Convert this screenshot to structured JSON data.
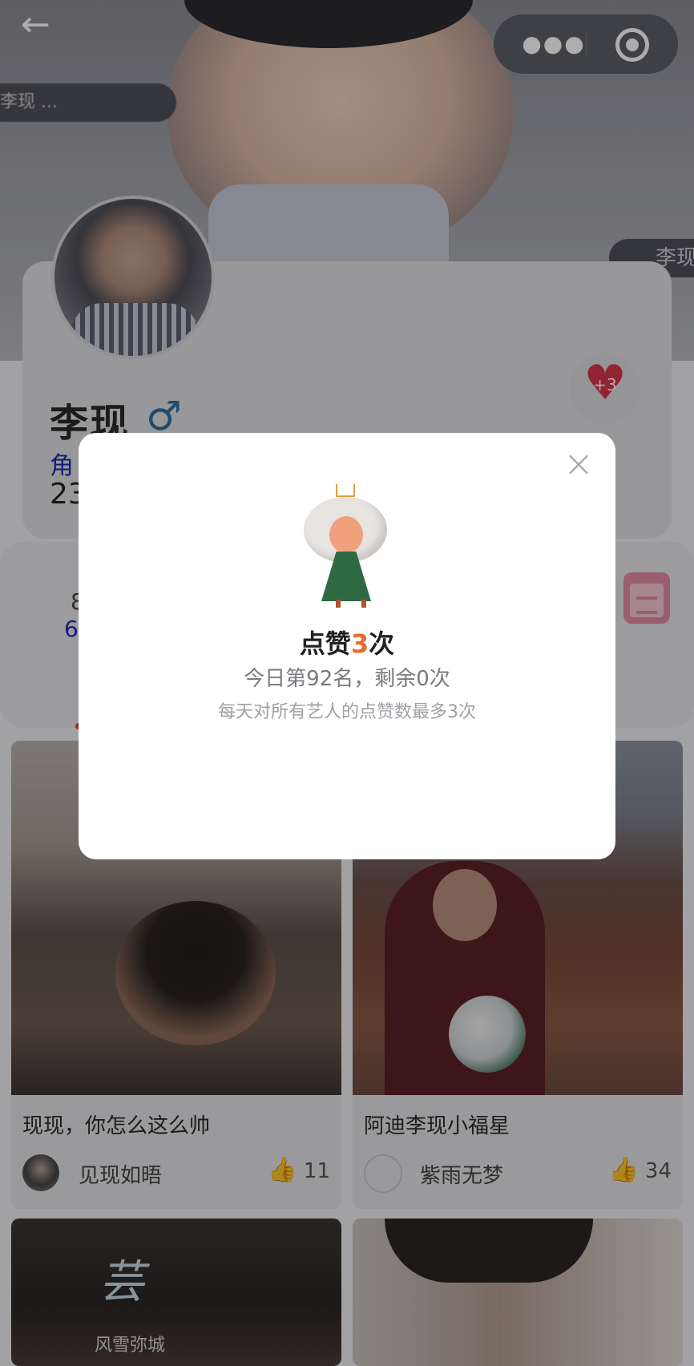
{
  "header": {
    "back_icon": "arrow-left-icon",
    "more_icon": "more-dots-icon",
    "close_capsule_icon": "target-icon",
    "blurred_pill_text": "李现 ...",
    "name_pill_text": "李现"
  },
  "profile": {
    "name": "李现",
    "gender_symbol": "♂",
    "role_text": "角",
    "age_text": "23",
    "heart_badge": "+3",
    "stat_partial_1": "8",
    "stat_partial_2": "6"
  },
  "modal": {
    "title_prefix": "点赞",
    "title_count": "3",
    "title_suffix": "次",
    "subtitle": "今日第92名，剩余0次",
    "note": "每天对所有艺人的点赞数最多3次",
    "close_icon": "close-icon"
  },
  "posts": [
    {
      "title": "现现，你怎么这么帅",
      "author": "见现如晤",
      "likes": "11"
    },
    {
      "title": "阿迪李现小福星",
      "author": "紫雨无梦",
      "likes": "34"
    },
    {
      "title": "",
      "author": "",
      "likes": "",
      "image_text_1": "风雪弥城",
      "image_text_2": "芸"
    },
    {
      "title": "",
      "author": "",
      "likes": ""
    }
  ],
  "colors": {
    "accent_orange": "#ec6a2a",
    "role_blue": "#1a2bb0",
    "heart_red": "#d8344a",
    "calendar_pink": "#e58aa6"
  }
}
